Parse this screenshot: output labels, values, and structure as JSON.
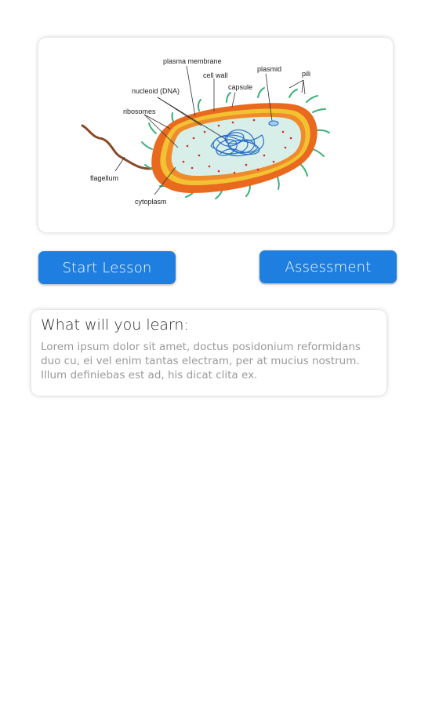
{
  "diagram": {
    "labels": {
      "plasma_membrane": "plasma membrane",
      "cell_wall": "cell wall",
      "capsule": "capsule",
      "plasmid": "plasmid",
      "pili": "pili",
      "nucleoid": "nucleoid (DNA)",
      "ribosomes": "ribosomes",
      "flagellum": "flagellum",
      "cytoplasm": "cytoplasm"
    },
    "colors": {
      "capsule": "#e96a1f",
      "cell_wall": "#f2c233",
      "cytoplasm": "#d8efe9",
      "dna": "#2a6fc9",
      "ribosome": "#d7262a",
      "pili": "#3bb07a",
      "flagellum": "#8a4a2a"
    }
  },
  "actions": {
    "start_lesson": "Start Lesson",
    "assessment": "Assessment"
  },
  "learn": {
    "title": "What will you learn:",
    "body": "Lorem ipsum dolor sit amet, doctus posidonium reformidans duo cu, ei vel enim tantas electram, per at mucius nostrum. Illum definiebas est ad, his dicat clita ex."
  },
  "theme": {
    "accent": "#1e7fe0",
    "background": "#ffffff"
  }
}
